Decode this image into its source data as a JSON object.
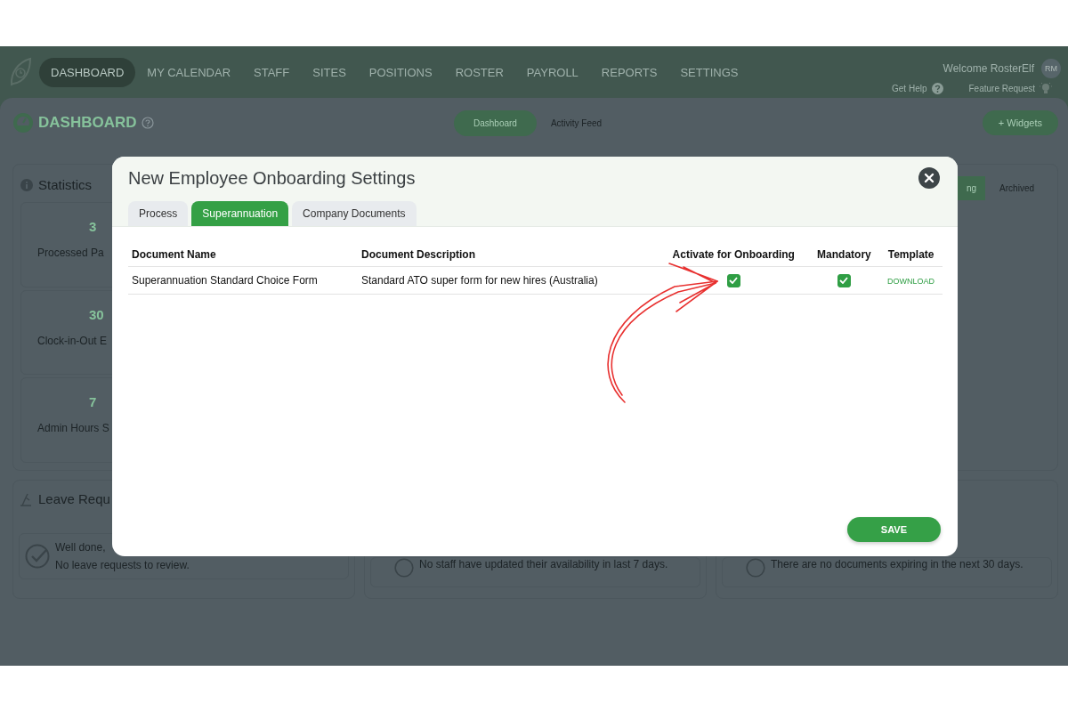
{
  "nav": {
    "items": [
      {
        "label": "DASHBOARD",
        "selected": true
      },
      {
        "label": "MY CALENDAR",
        "selected": false
      },
      {
        "label": "STAFF",
        "selected": false
      },
      {
        "label": "SITES",
        "selected": false
      },
      {
        "label": "POSITIONS",
        "selected": false
      },
      {
        "label": "ROSTER",
        "selected": false
      },
      {
        "label": "PAYROLL",
        "selected": false
      },
      {
        "label": "REPORTS",
        "selected": false
      },
      {
        "label": "SETTINGS",
        "selected": false
      }
    ],
    "welcome": "Welcome RosterElf",
    "avatar": "RM",
    "help_link": "Get Help",
    "feature_link": "Feature Request"
  },
  "page": {
    "title": "DASHBOARD",
    "views": [
      {
        "label": "Dashboard",
        "selected": true
      },
      {
        "label": "Activity Feed",
        "selected": false
      }
    ],
    "widgets_button": "+ Widgets"
  },
  "statistics": {
    "title": "Statistics",
    "stats": [
      {
        "value": "3",
        "label": "Processed Pa"
      },
      {
        "value": "30",
        "label": "Clock-in-Out E"
      },
      {
        "value": "7",
        "label": "Admin Hours S"
      }
    ]
  },
  "leave_requests": {
    "title": "Leave Requ",
    "message": [
      "Well done,",
      "No leave requests to review."
    ]
  },
  "availability": {
    "message": "No staff have updated their availability in last 7 days."
  },
  "documents": {
    "tabs": [
      {
        "label": "ng",
        "selected": true
      },
      {
        "label": "Archived",
        "selected": false
      }
    ],
    "message": "There are no documents expiring in the next 30 days."
  },
  "modal": {
    "title": "New Employee Onboarding Settings",
    "tabs": [
      {
        "label": "Process",
        "selected": false
      },
      {
        "label": "Superannuation",
        "selected": true
      },
      {
        "label": "Company Documents",
        "selected": false
      }
    ],
    "table": {
      "columns": [
        "Document Name",
        "Document Description",
        "Activate for Onboarding",
        "Mandatory",
        "Template"
      ],
      "rows": [
        {
          "name": "Superannuation Standard Choice Form",
          "description": "Standard ATO super form for new hires (Australia)",
          "activate": true,
          "mandatory": true,
          "template": "DOWNLOAD"
        }
      ]
    },
    "save_button": "SAVE"
  }
}
